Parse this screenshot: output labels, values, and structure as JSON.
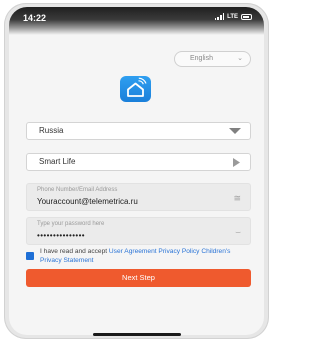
{
  "status_bar": {
    "time": "14:22",
    "network": "LTE"
  },
  "language_selector": {
    "value": "English",
    "icon": "chevron-down-icon"
  },
  "app_logo": {
    "icon": "smart-home-icon",
    "colors": [
      "#2f9ff0",
      "#1a7fda"
    ]
  },
  "region_select": {
    "value": "Russia"
  },
  "app_select": {
    "value": "Smart Life"
  },
  "account_field": {
    "placeholder": "Phone Number/Email Address",
    "value": "Youraccount@telemetrica.ru",
    "icon": "clear-icon"
  },
  "password_field": {
    "placeholder": "Type your password here",
    "value": "•••••••••••••••",
    "icon": "hidden-eye-icon"
  },
  "agreement": {
    "text_prefix": "I have read and accept ",
    "user_agreement": "User Agreement",
    "privacy_policy": "Privacy Policy",
    "children_privacy": "Children's Privacy Statement",
    "checked": true
  },
  "next_button": {
    "label": "Next Step",
    "color": "#ef5a2e"
  }
}
